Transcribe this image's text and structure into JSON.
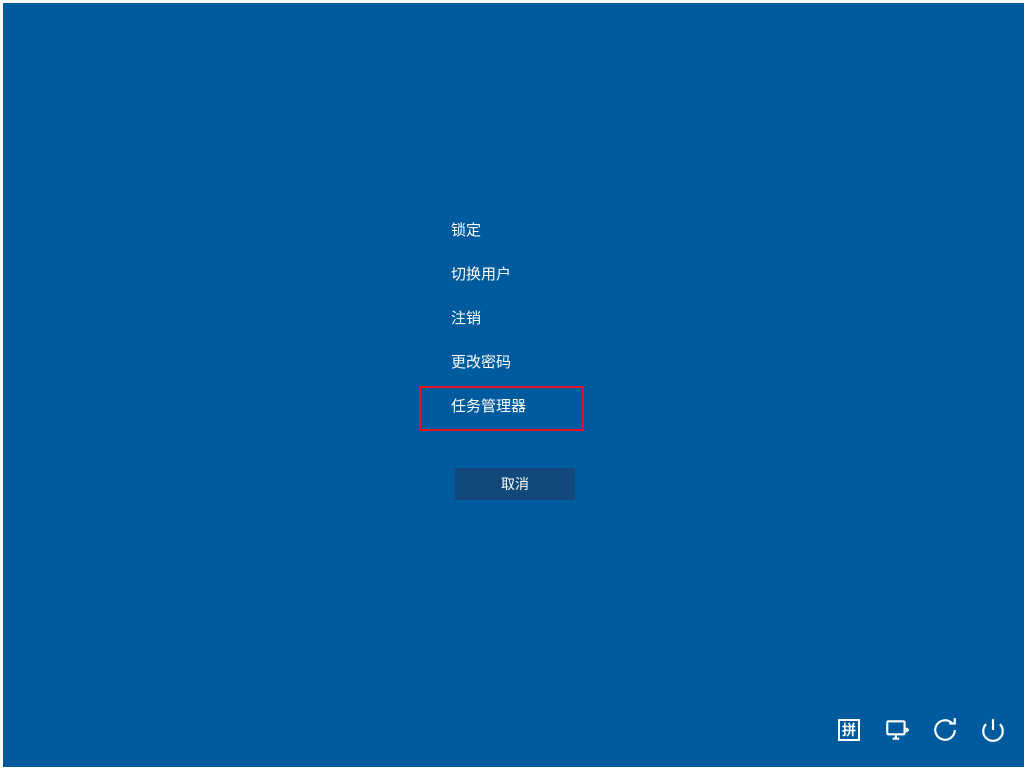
{
  "menu": {
    "items": [
      {
        "label": "锁定"
      },
      {
        "label": "切换用户"
      },
      {
        "label": "注销"
      },
      {
        "label": "更改密码"
      },
      {
        "label": "任务管理器"
      }
    ]
  },
  "cancel": {
    "label": "取消"
  },
  "tray": {
    "ime_label": "拼"
  },
  "highlight": {
    "target_index": 4,
    "color": "#e81123"
  },
  "colors": {
    "background": "#005a9e",
    "button_bg": "#12497a",
    "text": "#ffffff"
  }
}
